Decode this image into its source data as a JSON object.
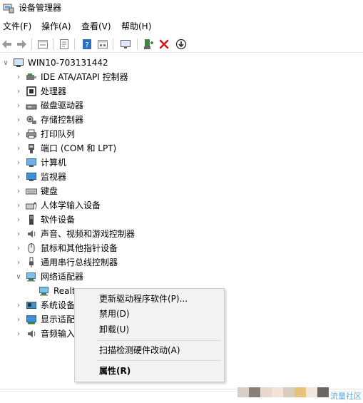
{
  "window": {
    "title": "设备管理器"
  },
  "menubar": [
    {
      "label": "文件(F)"
    },
    {
      "label": "操作(A)"
    },
    {
      "label": "查看(V)"
    },
    {
      "label": "帮助(H)"
    }
  ],
  "toolbar": {
    "buttons": [
      {
        "icon": "back-arrow-icon"
      },
      {
        "icon": "forward-arrow-icon"
      },
      {
        "icon": "show-hidden-icon"
      },
      {
        "icon": "properties-sheet-icon"
      },
      {
        "icon": "help-icon"
      },
      {
        "icon": "update-driver-icon"
      },
      {
        "icon": "monitor-icon"
      },
      {
        "icon": "add-device-icon"
      },
      {
        "icon": "uninstall-x-icon"
      },
      {
        "icon": "scan-download-icon"
      }
    ]
  },
  "tree": {
    "root": "WIN10-703131442",
    "items": [
      {
        "label": "IDE ATA/ATAPI 控制器",
        "icon": "ide-controller-icon"
      },
      {
        "label": "处理器",
        "icon": "processor-icon"
      },
      {
        "label": "磁盘驱动器",
        "icon": "disk-drive-icon"
      },
      {
        "label": "存储控制器",
        "icon": "storage-controller-icon"
      },
      {
        "label": "打印队列",
        "icon": "printer-icon"
      },
      {
        "label": "端口 (COM 和 LPT)",
        "icon": "port-icon"
      },
      {
        "label": "计算机",
        "icon": "computer-icon"
      },
      {
        "label": "监视器",
        "icon": "monitor-icon"
      },
      {
        "label": "键盘",
        "icon": "keyboard-icon"
      },
      {
        "label": "人体学输入设备",
        "icon": "hid-icon"
      },
      {
        "label": "软件设备",
        "icon": "software-device-icon"
      },
      {
        "label": "声音、视频和游戏控制器",
        "icon": "sound-icon"
      },
      {
        "label": "鼠标和其他指针设备",
        "icon": "mouse-icon"
      },
      {
        "label": "通用串行总线控制器",
        "icon": "usb-icon"
      },
      {
        "label": "网络适配器",
        "icon": "network-adapter-icon"
      },
      {
        "label": "Realt",
        "icon": "network-card-icon"
      },
      {
        "label": "系统设备",
        "icon": "system-device-icon"
      },
      {
        "label": "显示适配器",
        "icon": "display-adapter-icon"
      },
      {
        "label": "音频输入",
        "icon": "audio-input-icon"
      }
    ]
  },
  "context_menu": {
    "items": [
      {
        "label": "更新驱动程序软件(P)..."
      },
      {
        "label": "禁用(D)"
      },
      {
        "label": "卸载(U)"
      },
      {
        "label": "扫描检测硬件改动(A)"
      },
      {
        "label": "属性(R)"
      }
    ]
  },
  "watermark": "流量社区",
  "colors": {
    "accent": "#2a7fd4",
    "error": "#d0171b",
    "menu_bg": "#f2f2f2"
  }
}
